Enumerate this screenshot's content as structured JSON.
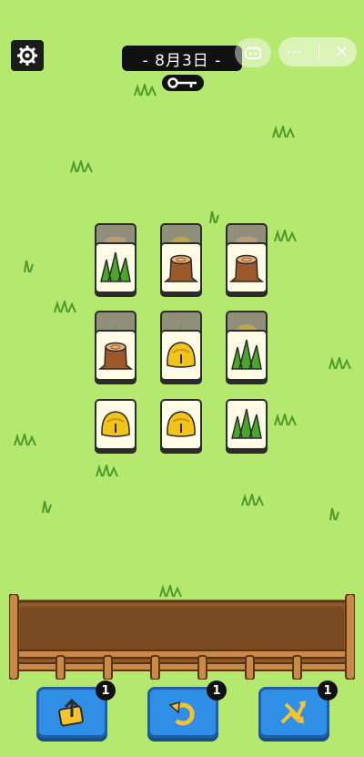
{
  "header": {
    "date_label": "- 8月3日 -"
  },
  "capsule": {
    "more_label": "···",
    "close_label": "✕"
  },
  "board": {
    "tiles": [
      {
        "row": 1,
        "col": 1,
        "item": "grass"
      },
      {
        "row": 1,
        "col": 2,
        "item": "tree-stump"
      },
      {
        "row": 1,
        "col": 3,
        "item": "tree-stump"
      },
      {
        "row": 2,
        "col": 1,
        "item": "tree-stump"
      },
      {
        "row": 2,
        "col": 2,
        "item": "bell"
      },
      {
        "row": 2,
        "col": 3,
        "item": "grass"
      },
      {
        "row": 3,
        "col": 1,
        "item": "bell"
      },
      {
        "row": 3,
        "col": 2,
        "item": "bell"
      },
      {
        "row": 3,
        "col": 3,
        "item": "grass"
      }
    ],
    "covered_tiles": [
      "tree-stump",
      "bell",
      "tree-stump",
      "grass",
      "grass",
      "bell"
    ]
  },
  "powerups": [
    {
      "name": "move-out",
      "icon": "move-out-icon",
      "count": "1"
    },
    {
      "name": "undo",
      "icon": "undo-icon",
      "count": "1"
    },
    {
      "name": "shuffle",
      "icon": "shuffle-icon",
      "count": "1"
    }
  ],
  "colors": {
    "background": "#b5e86f",
    "button": "#2f8ee6",
    "tray": "#8c5a2b"
  }
}
